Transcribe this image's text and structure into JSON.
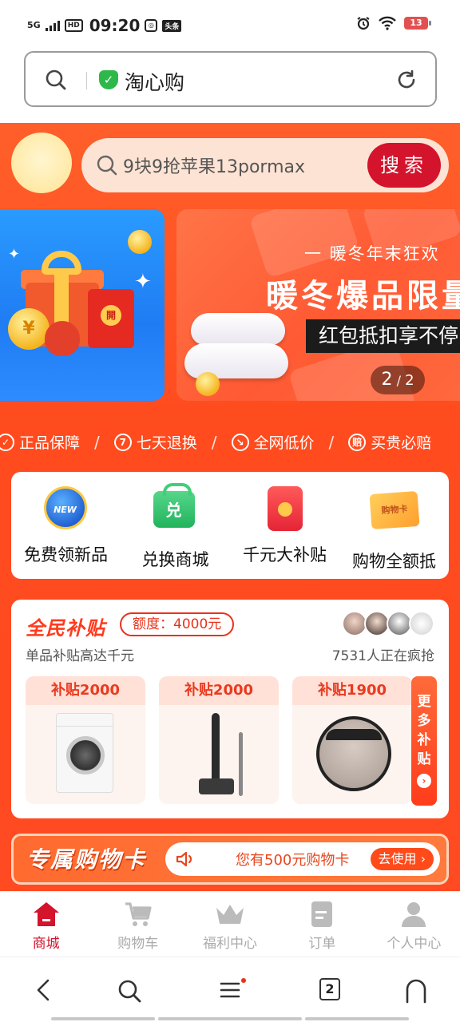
{
  "status_bar": {
    "network": "5G",
    "hd": "HD",
    "time": "09:20",
    "app_badge": "头条",
    "battery": "13"
  },
  "browser": {
    "site_title": "淘心购",
    "search_icon": "search-icon",
    "refresh_icon": "refresh-icon",
    "secure_icon": "shield-check-icon"
  },
  "header": {
    "search_placeholder": "9块9抢苹果13pormax",
    "search_button": "搜索"
  },
  "banner": {
    "left_envelope_char": "開",
    "left_coin_char": "¥",
    "subtitle": "一  暖冬年末狂欢",
    "title": "暖冬爆品限量",
    "tag": "红包抵扣享不停",
    "page_current": "2",
    "page_separator": "/",
    "page_total": "2"
  },
  "guarantees": [
    {
      "icon": "✓",
      "label": "正品保障"
    },
    {
      "icon": "7",
      "label": "七天退换"
    },
    {
      "icon": "↘",
      "label": "全网低价"
    },
    {
      "icon": "赔",
      "label": "买贵必赔"
    }
  ],
  "guarantee_separator": "/",
  "entries": [
    {
      "label": "免费领新品",
      "badge": "NEW"
    },
    {
      "label": "兑换商城",
      "badge": "兑"
    },
    {
      "label": "千元大补贴",
      "badge": ""
    },
    {
      "label": "购物全额抵",
      "badge": "购物卡"
    }
  ],
  "subsidy": {
    "title": "全民补贴",
    "quota": "额度：4000元",
    "desc": "单品补贴高达千元",
    "count": "7531人正在疯抢",
    "products": [
      {
        "tag": "补贴2000",
        "item": "washing-machine"
      },
      {
        "tag": "补贴2000",
        "item": "wet-dry-vacuum"
      },
      {
        "tag": "补贴1900",
        "item": "robot-vacuum"
      }
    ],
    "more_label": "更多补贴",
    "more_chars": [
      "更",
      "多",
      "补",
      "贴"
    ],
    "more_arrow": "›"
  },
  "card_banner": {
    "title": "专属购物卡",
    "text": "您有500元购物卡",
    "button": "去使用 ›"
  },
  "tabs": [
    {
      "label": "商城",
      "icon": "home-icon",
      "active": true
    },
    {
      "label": "购物车",
      "icon": "cart-icon",
      "active": false
    },
    {
      "label": "福利中心",
      "icon": "crown-icon",
      "active": false
    },
    {
      "label": "订单",
      "icon": "order-icon",
      "active": false
    },
    {
      "label": "个人中心",
      "icon": "user-icon",
      "active": false
    }
  ],
  "system_nav": {
    "tab_count": "2"
  },
  "colors": {
    "brand_orange": "#ff4b1e",
    "accent_red": "#d4132c",
    "secure_green": "#2eb84a"
  }
}
